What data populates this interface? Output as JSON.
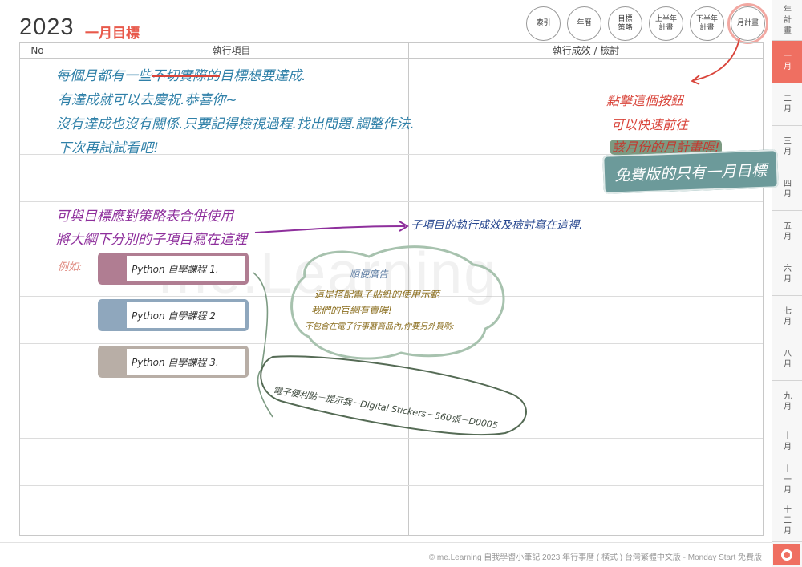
{
  "header": {
    "year": "2023",
    "title": "一月目標"
  },
  "top_buttons": [
    {
      "label": "索引",
      "name": "index"
    },
    {
      "label": "年曆",
      "name": "year-calendar"
    },
    {
      "label": "目標\n策略",
      "name": "goal-strategy"
    },
    {
      "label": "上半年\n計畫",
      "name": "first-half-plan"
    },
    {
      "label": "下半年\n計畫",
      "name": "second-half-plan"
    },
    {
      "label": "月計畫",
      "name": "monthly-plan"
    }
  ],
  "rail": [
    {
      "label": "年\n計\n畫"
    },
    {
      "label": "一\n月"
    },
    {
      "label": "二\n月"
    },
    {
      "label": "三\n月"
    },
    {
      "label": "四\n月"
    },
    {
      "label": "五\n月"
    },
    {
      "label": "六\n月"
    },
    {
      "label": "七\n月"
    },
    {
      "label": "八\n月"
    },
    {
      "label": "九\n月"
    },
    {
      "label": "十\n月"
    },
    {
      "label": "十\n一\n月"
    },
    {
      "label": "十\n二\n月"
    }
  ],
  "table": {
    "col_no": "No",
    "col_items": "執行項目",
    "col_results": "執行成效 / 檢討"
  },
  "handwriting": {
    "line1_a": "每個月都有一些",
    "line1_strike": "不切實際的",
    "line1_b": "目標想要達成.",
    "line2": "有達成就可以去慶祝.恭喜你~",
    "line3": "沒有達成也沒有關係.只要記得檢視過程.找出問題.調整作法.",
    "line4": "下次再試試看吧!",
    "purple1": "可與目標應對策略表合併使用",
    "purple2": "將大綱下分別的子項目寫在這裡",
    "navy": "子項目的執行成效及檢討寫在這裡.",
    "example": "例如:",
    "red1": "點擊這個按鈕",
    "red2": "可以快速前往",
    "red3": "該月份的月計畫喔!",
    "free_note": "免費版的只有一月目標",
    "ad_title": "順便廣告",
    "ad1": "這是搭配電子貼紙的使用示範",
    "ad2": "我們的官網有賣喔!",
    "ad3": "不包含在電子行事曆商品內,你要另外買喲:",
    "ad_product": "電子便利貼－提示我－Digital Stickers－560張－D0005"
  },
  "stickers": [
    {
      "label": "Python 自學課程 1.",
      "color": "#b07d92"
    },
    {
      "label": "Python 自學課程 2",
      "color": "#8fa7bd"
    },
    {
      "label": "Python 自學課程 3.",
      "color": "#b8aea6"
    }
  ],
  "watermark": "me.Learning",
  "footer": "© me.Learning 自我學習小筆記 2023 年行事曆 ( 橫式 ) 台灣繁體中文版 - Monday Start 免費版",
  "colors": {
    "accent": "#ef6f61",
    "highlight": "#f2a8a2"
  }
}
